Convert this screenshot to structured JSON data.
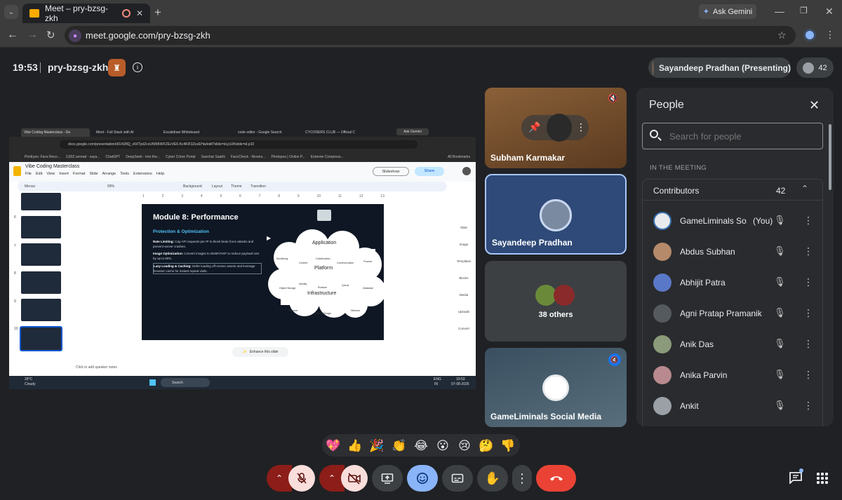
{
  "browser": {
    "tab_title": "Meet – pry-bzsg-zkh",
    "ask_gemini": "Ask Gemini",
    "url": "meet.google.com/pry-bzsg-zkh"
  },
  "meeting": {
    "time": "19:53",
    "code": "pry-bzsg-zkh",
    "presenter_chip": "Sayandeep Pradhan (Presenting)",
    "participant_count": "42"
  },
  "shared_screen": {
    "tabs": [
      "Vibe Coding Masterclass - Go",
      "Meet - Full Stack with AI",
      "Excalidraw Whiteboard",
      "code editor - Google Search",
      "CYCODERS CLUB — Official C"
    ],
    "ask_gemini": "Ask Gemini",
    "url": "docs.google.com/presentation/d/1I428Q_v6XTjelZcoUW9KWFZEvVE6-Kc4KlF3ZozEHw/edit?slide=id.p10#slide=id.p10",
    "bookmarks": [
      "PimEyes: Face Reco...",
      "3,832 unread - saya...",
      "ChatGPT",
      "DeepSeek - Into the...",
      "Cyber Crime Portal",
      "Sanchar Saathi",
      "FaceCheck - Revers...",
      "Photopea | Online P...",
      "Extreme Compress..."
    ],
    "all_bookmarks": "All Bookmarks",
    "doc_title": "Vibe Coding Masterclass",
    "menu": [
      "File",
      "Edit",
      "View",
      "Insert",
      "Format",
      "Slide",
      "Arrange",
      "Tools",
      "Extensions",
      "Help"
    ],
    "slideshow": "Slideshow",
    "share": "Share",
    "toolbar": [
      "Menus",
      "69%",
      "Background",
      "Layout",
      "Theme",
      "Transition"
    ],
    "ruler": [
      "1",
      "2",
      "3",
      "4",
      "5",
      "6",
      "7",
      "8",
      "9",
      "10",
      "11",
      "12",
      "13"
    ],
    "thumb_numbers": [
      "6",
      "7",
      "8",
      "9",
      "10"
    ],
    "slide": {
      "title": "Module 8: Performance",
      "subtitle": "Protection & Optimization",
      "b1_head": "Rate Limiting:",
      "b1_text": "Cap API requests per IP to block brute force attacks and prevent server crashes.",
      "b2_head": "Image Optimization:",
      "b2_text": "Convert images to WebP/AVIF to reduce payload size by up to 80%.",
      "b3_head": "Lazy Loading & Caching:",
      "b3_text": "Defer loading off-screen assets and leverage browser cache for instant repeat visits.",
      "cloud_labels": [
        "Application",
        "Platform",
        "Infrastructure"
      ],
      "cloud_items": [
        "Monitoring",
        "Content",
        "Collaboration",
        "Communication",
        "Finance",
        "Object Storage",
        "Identity",
        "Runtime",
        "Queue",
        "Database",
        "Compute",
        "Block Storage",
        "Network"
      ]
    },
    "side_panel": [
      "Slide",
      "Image",
      "Templates",
      "Blocks",
      "Media",
      "Uploads",
      "Convert"
    ],
    "enhance": "Enhance this slide",
    "speaker_notes": "Click to add speaker notes",
    "taskbar": {
      "weather_temp": "28°C",
      "weather_text": "Cloudy",
      "search": "Search",
      "lang1": "ENG",
      "lang2": "IN",
      "time": "19:53",
      "date": "07-08-2026"
    }
  },
  "tiles": [
    {
      "name": "Subham Karmakar",
      "color": "#7a5430"
    },
    {
      "name": "Sayandeep Pradhan",
      "color": "#2f4a78"
    },
    {
      "name": "38 others",
      "color": "#3c4043"
    },
    {
      "name": "GameLiminals Social Media",
      "color": "#4a5d6c"
    }
  ],
  "people_panel": {
    "title": "People",
    "search_placeholder": "Search for people",
    "section": "IN THE MEETING",
    "group": "Contributors",
    "group_count": "42",
    "you_label": "(You)",
    "rows": [
      {
        "name": "GameLiminals So...",
        "color": "#e8eaed"
      },
      {
        "name": "Abdus Subhan",
        "color": "#b58a6a"
      },
      {
        "name": "Abhijit Patra",
        "color": "#5a78c8"
      },
      {
        "name": "Agni Pratap Pramanik",
        "color": "#555a5e"
      },
      {
        "name": "Anik Das",
        "color": "#8a9a7a"
      },
      {
        "name": "Anika Parvin",
        "color": "#b88a90"
      },
      {
        "name": "Ankit",
        "color": "#9aa0a6"
      }
    ]
  },
  "reactions": [
    "💖",
    "👍",
    "🎉",
    "👏",
    "😂",
    "😮",
    "😢",
    "🤔",
    "👎"
  ],
  "colors": {
    "end_call": "#ea4335",
    "mic_off": "#f9dedc",
    "accent_blue": "#8ab4f8",
    "background": "#202124"
  }
}
